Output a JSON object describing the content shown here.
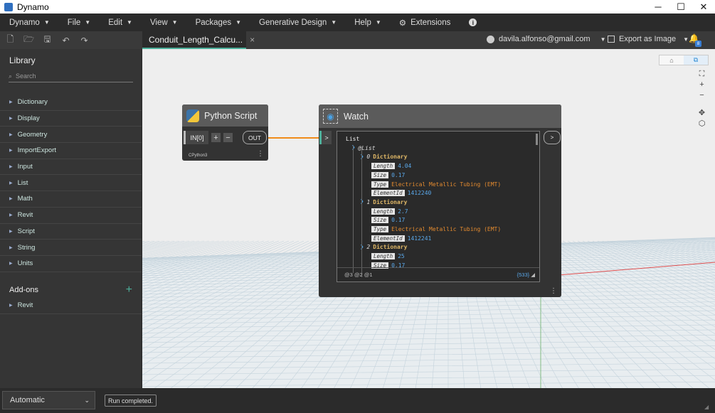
{
  "window": {
    "title": "Dynamo",
    "minimize": "─",
    "maximize": "☐",
    "close": "✕"
  },
  "menu": [
    {
      "label": "Dynamo",
      "caret": "▼"
    },
    {
      "label": "File",
      "caret": "▼"
    },
    {
      "label": "Edit",
      "caret": "▼"
    },
    {
      "label": "View",
      "caret": "▼"
    },
    {
      "label": "Packages",
      "caret": "▼"
    },
    {
      "label": "Generative Design",
      "caret": "▼"
    },
    {
      "label": "Help",
      "caret": "▼"
    }
  ],
  "extensions": {
    "label": "Extensions",
    "icon": "puzzle-icon"
  },
  "info_icon": "i",
  "tab": {
    "label": "Conduit_Length_Calcu...",
    "close": "×"
  },
  "user": {
    "email": "davila.alfonso@gmail.com"
  },
  "export": {
    "label": "Export as Image"
  },
  "notifications": {
    "badge": "8"
  },
  "library": {
    "title": "Library",
    "search_placeholder": "Search",
    "items": [
      "Dictionary",
      "Display",
      "Geometry",
      "ImportExport",
      "Input",
      "List",
      "Math",
      "Revit",
      "Script",
      "String",
      "Units"
    ],
    "addons_title": "Add-ons",
    "addons_items": [
      "Revit"
    ]
  },
  "python_node": {
    "title": "Python Script",
    "input_port": "IN[0]",
    "add": "+",
    "remove": "−",
    "output_port": "OUT",
    "engine": "CPython3"
  },
  "watch_node": {
    "title": "Watch",
    "input_port": ">",
    "output_port": ">",
    "root": "List",
    "sublist": "@List",
    "entries": [
      {
        "index": "0",
        "type": "Dictionary",
        "fields": [
          {
            "key": "Length",
            "value": "4.04",
            "kind": "num"
          },
          {
            "key": "Size",
            "value": "0.17",
            "kind": "num"
          },
          {
            "key": "Type",
            "value": "Electrical Metallic Tubing (EMT)",
            "kind": "str"
          },
          {
            "key": "ElementId",
            "value": "1412240",
            "kind": "num"
          }
        ]
      },
      {
        "index": "1",
        "type": "Dictionary",
        "fields": [
          {
            "key": "Length",
            "value": "2.7",
            "kind": "num"
          },
          {
            "key": "Size",
            "value": "0.17",
            "kind": "num"
          },
          {
            "key": "Type",
            "value": "Electrical Metallic Tubing (EMT)",
            "kind": "str"
          },
          {
            "key": "ElementId",
            "value": "1412241",
            "kind": "num"
          }
        ]
      },
      {
        "index": "2",
        "type": "Dictionary",
        "fields": [
          {
            "key": "Length",
            "value": "25",
            "kind": "num"
          },
          {
            "key": "Size",
            "value": "0.17",
            "kind": "num"
          }
        ]
      }
    ],
    "levels": "@3 @2 @1",
    "count": "{533}"
  },
  "statusbar": {
    "run_mode": "Automatic",
    "message": "Run completed."
  }
}
